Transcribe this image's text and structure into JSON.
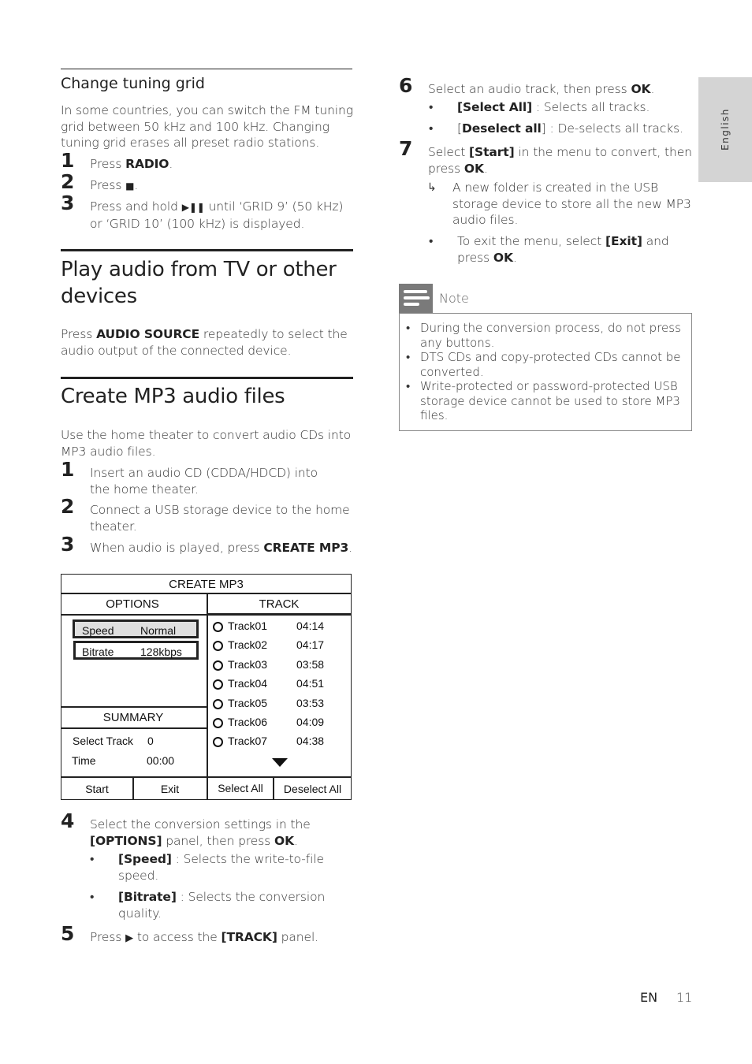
{
  "left_column": {
    "change_tuning_grid": {
      "heading": "Change tuning grid",
      "intro": "In some countries, you can switch the FM tuning grid between 50 kHz and 100 kHz. Changing tuning grid erases all preset radio stations.",
      "steps": [
        {
          "num": "1",
          "pre": "Press ",
          "bold": "RADIO",
          "post": "."
        },
        {
          "num": "2",
          "pre": "Press ",
          "icon": "stop-icon",
          "glyph": "■",
          "post": "."
        },
        {
          "num": "3",
          "pre": "Press and hold ",
          "icon": "play-pause-icon",
          "glyph": "▶❚❚",
          "post_line1": " until ‘GRID 9’ (50 kHz)",
          "post_line2": "or ‘GRID 10’ (100 kHz) is displayed."
        }
      ]
    },
    "play_audio": {
      "heading_line1": "Play audio from TV or other",
      "heading_line2": "devices",
      "text_pre": "Press ",
      "text_bold": "AUDIO SOURCE",
      "text_post_line1": " repeatedly to select the",
      "text_line2": "audio output of the connected device."
    },
    "create_mp3": {
      "heading": "Create MP3 audio files",
      "intro_line1": "Use the home theater to convert audio CDs into",
      "intro_line2": "MP3 audio files.",
      "steps": [
        {
          "num": "1",
          "line1": "Insert an audio CD (CDDA/HDCD) into",
          "line2": "the home theater."
        },
        {
          "num": "2",
          "line1": "Connect a USB storage device to the home",
          "line2": "theater."
        },
        {
          "num": "3",
          "pre": "When audio is played, press ",
          "bold": "CREATE MP3",
          "post": "."
        }
      ]
    },
    "diagram": {
      "title": "CREATE MP3",
      "options_header": "OPTIONS",
      "track_header": "TRACK",
      "options": [
        {
          "label": "Speed",
          "value": "Normal",
          "highlighted": true
        },
        {
          "label": "Bitrate",
          "value": "128kbps",
          "highlighted": false
        }
      ],
      "summary_header": "SUMMARY",
      "summary": [
        {
          "label": "Select Track",
          "value": "0"
        },
        {
          "label": "Time",
          "value": "00:00"
        }
      ],
      "tracks": [
        {
          "name": "Track01",
          "duration": "04:14"
        },
        {
          "name": "Track02",
          "duration": "04:17"
        },
        {
          "name": "Track03",
          "duration": "03:58"
        },
        {
          "name": "Track04",
          "duration": "04:51"
        },
        {
          "name": "Track05",
          "duration": "03:53"
        },
        {
          "name": "Track06",
          "duration": "04:09"
        },
        {
          "name": "Track07",
          "duration": "04:38"
        }
      ],
      "buttons": {
        "start": "Start",
        "exit": "Exit",
        "select_all": "Select All",
        "deselect_all": "Deselect All"
      }
    },
    "steps_after": {
      "step4": {
        "num": "4",
        "line1": "Select the conversion settings in the",
        "line2_bold": "[OPTIONS]",
        "line2_mid": " panel, then press ",
        "line2_bold2": "OK",
        "line2_post": ".",
        "bullets": [
          {
            "bold": "[Speed]",
            "line1": " : Selects the write-to-file",
            "line2": "speed."
          },
          {
            "bold": "[Bitrate]",
            "line1": " : Selects the conversion",
            "line2": "quality."
          }
        ]
      },
      "step5": {
        "num": "5",
        "pre": "Press ",
        "glyph": "▶",
        "mid": " to access the ",
        "bold": "[TRACK]",
        "post": " panel."
      }
    }
  },
  "right_column": {
    "step6": {
      "num": "6",
      "pre": "Select an audio track, then press ",
      "bold": "OK",
      "post": ".",
      "bullets": [
        {
          "bold": "[Select All]",
          "rest": " : Selects all tracks."
        },
        {
          "pre": "[",
          "bold": "Deselect all",
          "rest": "] : De-selects all tracks."
        }
      ]
    },
    "step7": {
      "num": "7",
      "pre": "Select ",
      "bold": "[Start]",
      "post_line1": " in the menu to convert, then",
      "line2_pre": "press ",
      "line2_bold": "OK",
      "line2_post": ".",
      "result_arrow": "↳",
      "result_lines": [
        "A new folder is created in the USB",
        "storage device to store all the new MP3",
        "audio files."
      ],
      "bullet_pre": "To exit the menu, select ",
      "bullet_bold": "[Exit]",
      "bullet_post": " and",
      "bullet_line2_pre": "press ",
      "bullet_line2_bold": "OK",
      "bullet_line2_post": "."
    },
    "note": {
      "title": "Note",
      "items": [
        [
          "During the conversion process, do not press",
          "any buttons."
        ],
        [
          "DTS CDs and copy-protected CDs cannot be",
          "converted."
        ],
        [
          "Write-protected or password-protected USB",
          "storage device cannot be used to store MP3",
          "files."
        ]
      ]
    }
  },
  "side_tab": {
    "language": "English"
  },
  "footer": {
    "lang_code": "EN",
    "page_number": "11"
  }
}
